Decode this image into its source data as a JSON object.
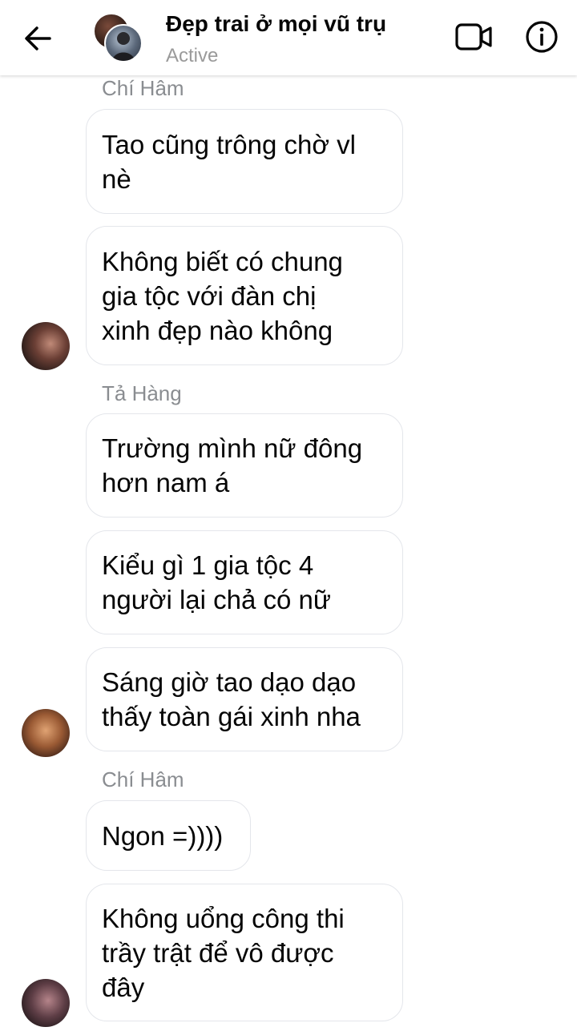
{
  "header": {
    "title": "Đẹp trai ở mọi vũ trụ",
    "status": "Active",
    "icons": {
      "back": "arrow-left-icon",
      "video": "video-camera-icon",
      "info": "info-circle-icon"
    }
  },
  "messages": [
    {
      "sender": "Chí Hâm"
    },
    {
      "text_lines": [
        "Tao cũng trông chờ vl",
        "nè"
      ]
    },
    {
      "text_lines": [
        "Không biết có chung",
        "gia tộc với đàn chị",
        "xinh đẹp nào không"
      ]
    },
    {
      "sender": "Tả Hàng"
    },
    {
      "text_lines": [
        "Trường mình nữ đông",
        "hơn nam á"
      ]
    },
    {
      "text_lines": [
        "Kiểu gì 1 gia tộc 4",
        "người lại chả có nữ"
      ]
    },
    {
      "text_lines": [
        "Sáng giờ tao dạo dạo",
        "thấy toàn gái xinh nha"
      ]
    },
    {
      "sender": "Chí Hâm"
    },
    {
      "text_lines": [
        "Ngon =))))"
      ]
    },
    {
      "text_lines": [
        "Không uổng công thi",
        "trầy trật để vô được",
        "đây"
      ]
    }
  ]
}
